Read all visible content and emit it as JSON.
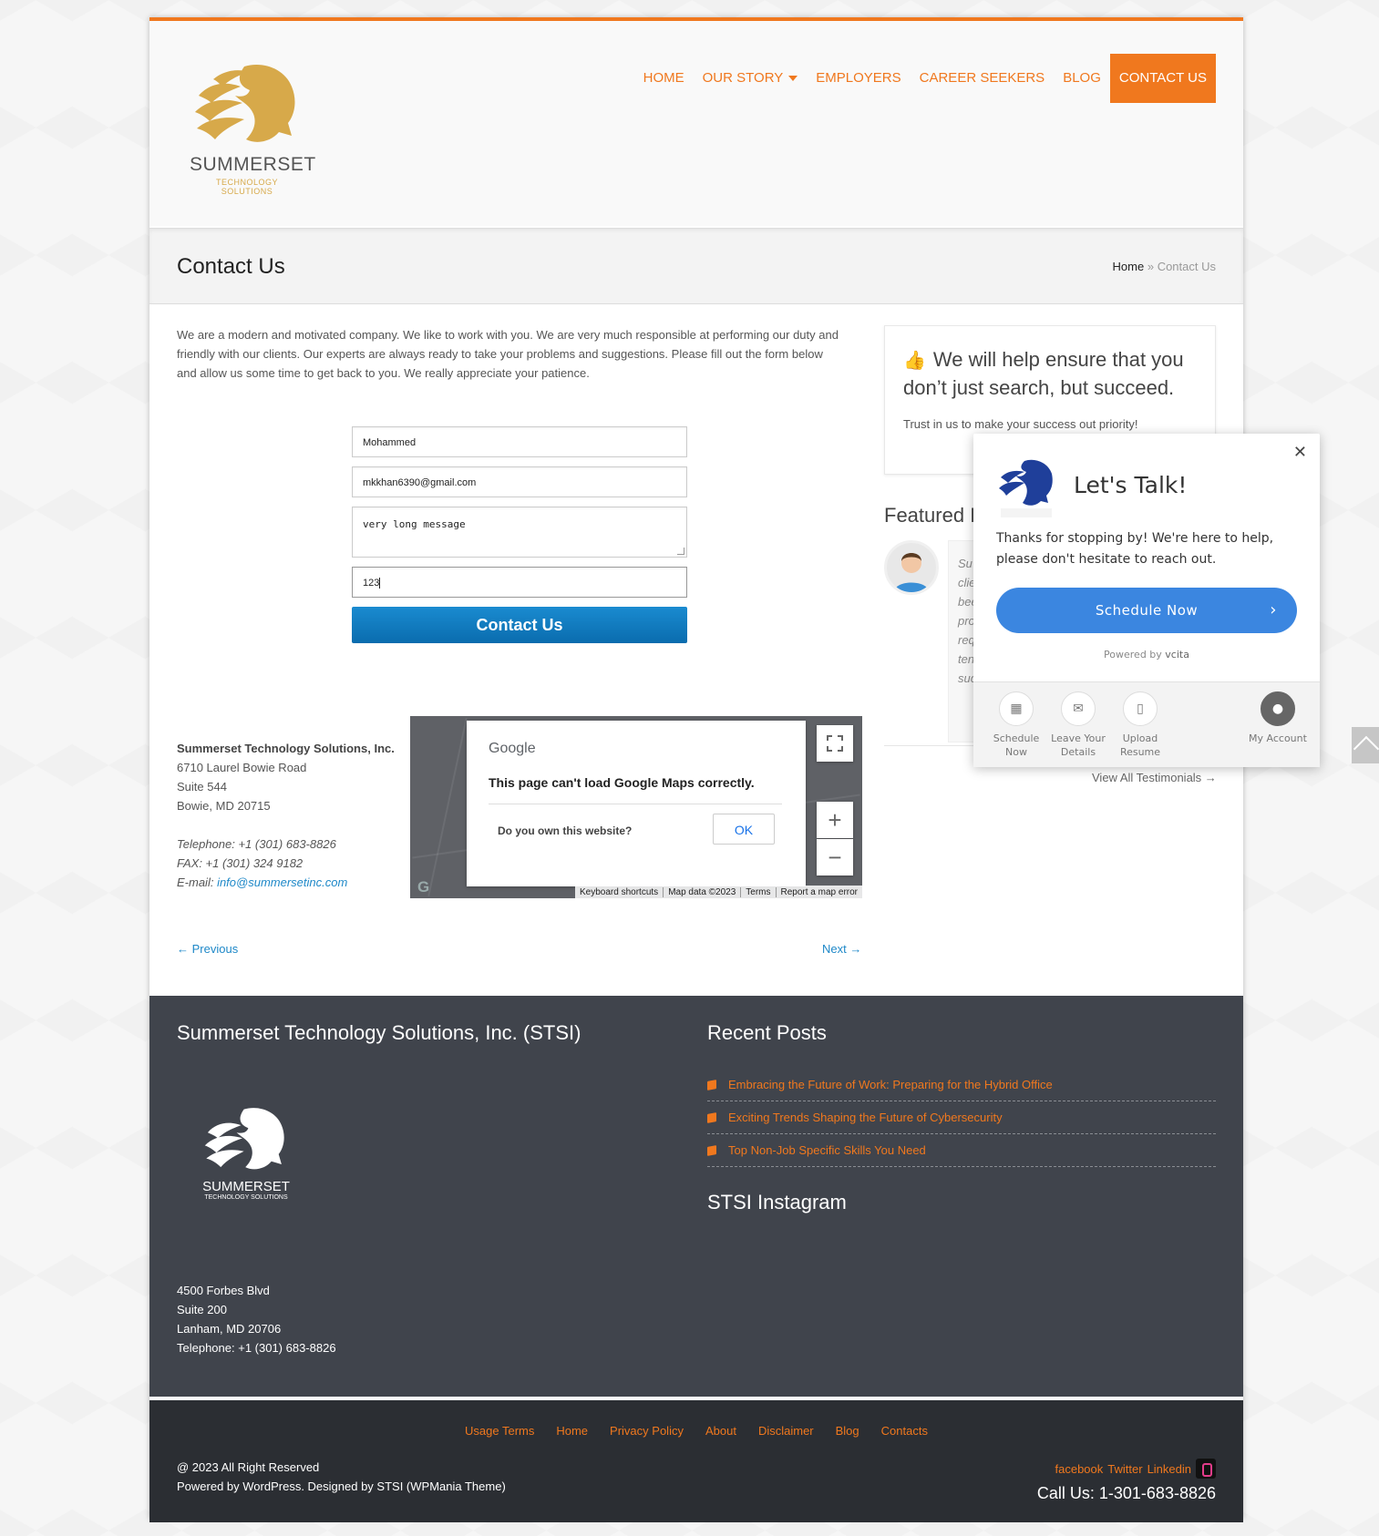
{
  "nav": {
    "items": [
      "HOME",
      "OUR STORY",
      "EMPLOYERS",
      "CAREER SEEKERS",
      "BLOG",
      "CONTACT US"
    ]
  },
  "logo": {
    "name": "SUMMERSET",
    "sub": "TECHNOLOGY SOLUTIONS"
  },
  "titlebar": {
    "title": "Contact Us",
    "crumb_home": "Home",
    "crumb_sep": " » ",
    "crumb_current": "Contact Us"
  },
  "intro": "We are a modern and motivated company. We like to work with you. We are very much responsible at performing our duty and friendly with our clients. Our experts are always ready to take your problems and suggestions. Please fill out the form below and allow us some time to get back to you.  We really appreciate your patience.",
  "form": {
    "name": "Mohammed",
    "email": "mkkhan6390@gmail.com",
    "message": "very long message",
    "captcha": "123",
    "submit": "Contact Us"
  },
  "address": {
    "company": "Summerset Technology Solutions, Inc.",
    "line1": "6710 Laurel Bowie Road",
    "line2": "Suite 544",
    "line3": "Bowie, MD 20715",
    "telephone": "Telephone: +1 (301) 683-8826",
    "fax": "FAX: +1 (301) 324 9182",
    "email_label": "E-mail: ",
    "email": "info@summersetinc.com"
  },
  "map": {
    "brand": "Google",
    "error": "This page can't load Google Maps correctly.",
    "question": "Do you own this website?",
    "ok": "OK",
    "attribution": [
      "Keyboard shortcuts",
      "Map data ©2023",
      "Terms",
      "Report a map error"
    ],
    "zoom_in": "+",
    "zoom_out": "−"
  },
  "pager": {
    "prev": "← Previous",
    "next": "Next →"
  },
  "sidebar": {
    "promo_title": "We will help ensure that you don’t just search, but succeed.",
    "promo_text": "Trust in us to make your success out priority!",
    "featured": "Featured I",
    "testimonial_fragment": "Su clie bee pro req ten suc",
    "all_testimonials": "View All Testimonials →"
  },
  "footer": {
    "company_heading": "Summerset Technology Solutions, Inc. (STSI)",
    "posts_heading": "Recent Posts",
    "posts": [
      "Embracing the Future of Work: Preparing for the Hybrid Office",
      "Exciting Trends Shaping the Future of Cybersecurity",
      "Top Non-Job Specific Skills You Need"
    ],
    "instagram_heading": "STSI Instagram",
    "addr1": "4500 Forbes Blvd",
    "addr2": "Suite 200",
    "addr3": "Lanham, MD 20706",
    "phone": "Telephone: +1 (301) 683-8826"
  },
  "bottom": {
    "links": [
      "Usage Terms",
      "Home",
      "Privacy Policy",
      "About",
      "Disclaimer",
      "Blog",
      "Contacts"
    ],
    "copyright": "@ 2023 All Right Reserved",
    "powered": "Powered by WordPress. Designed by STSI (WPMania Theme)",
    "social": [
      "facebook",
      "Twitter",
      "Linkedin"
    ],
    "call": "Call Us: 1-301-683-8826"
  },
  "vcita": {
    "title": "Let's Talk!",
    "message": "Thanks for stopping by! We're here to help, please don't hesitate to reach out.",
    "schedule": "Schedule Now",
    "powered_prefix": "Powered by ",
    "powered_brand": "vcita",
    "buttons": [
      "Schedule Now",
      "Leave Your Details",
      "Upload Resume",
      "My Account"
    ]
  },
  "colors": {
    "accent": "#f0781e",
    "link": "#1e88c8",
    "footer": "#40444c",
    "vcita_blue": "#3b86e0"
  }
}
